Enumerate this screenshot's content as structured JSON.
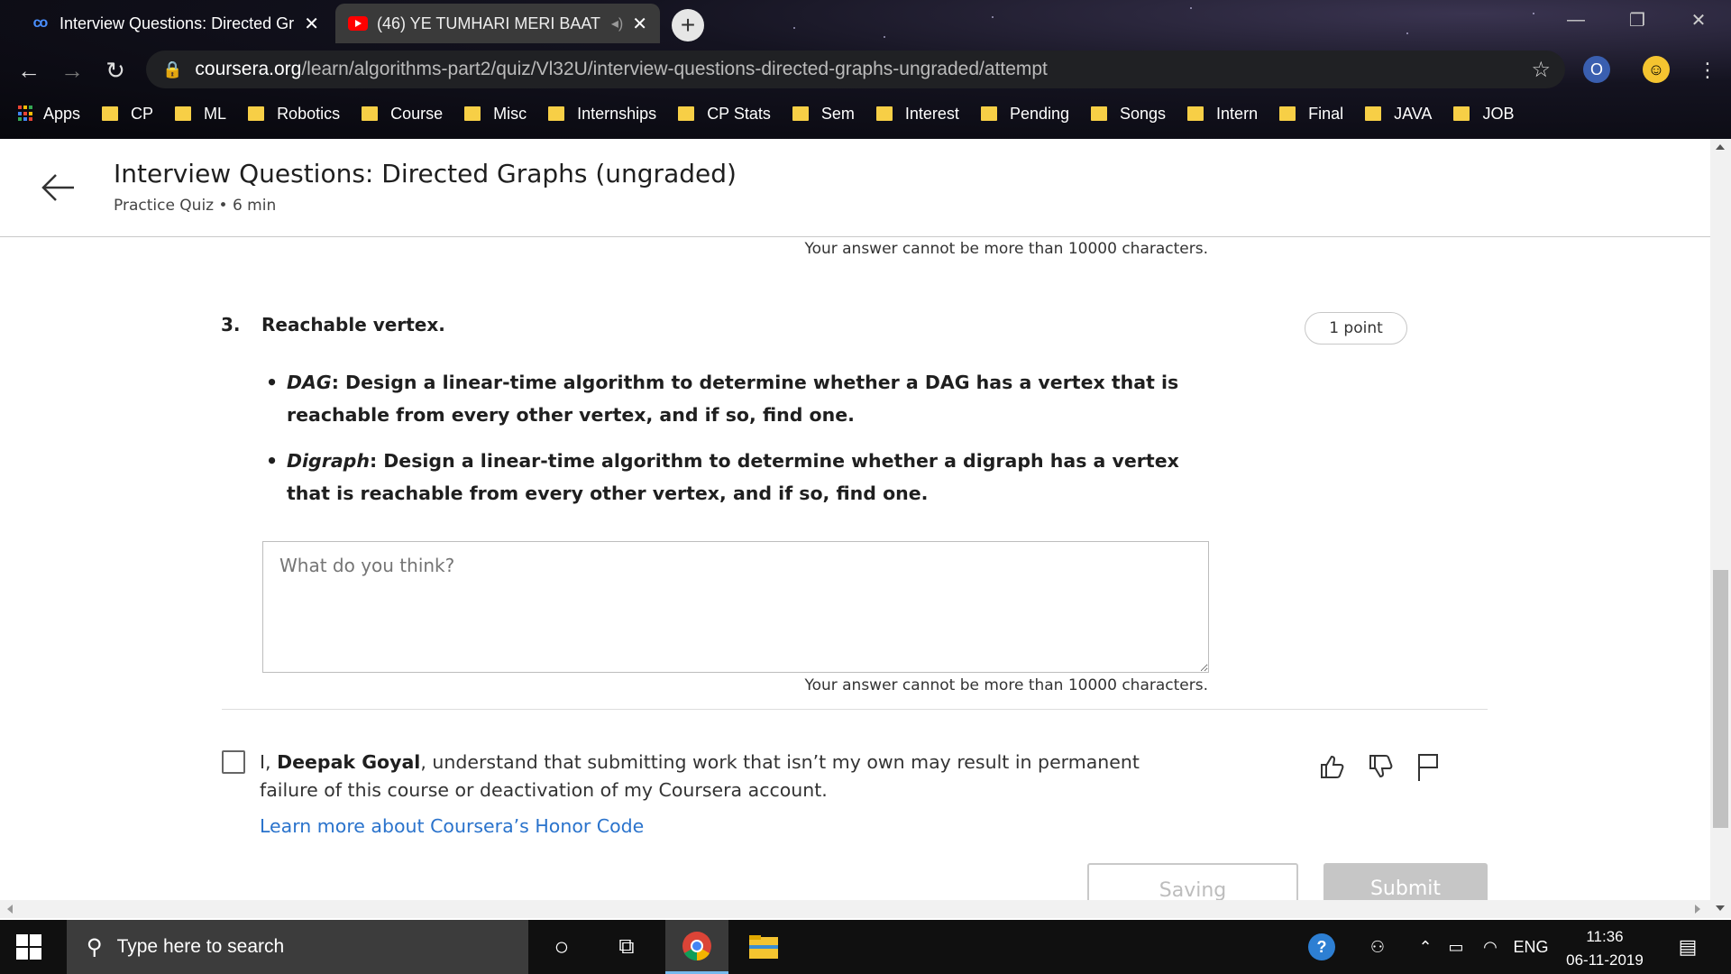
{
  "browser": {
    "tabs": [
      {
        "title": "Interview Questions: Directed Gr",
        "active": true
      },
      {
        "title": "(46) YE TUMHARI MERI BAAT",
        "active": false
      }
    ],
    "url_domain": "coursera.org",
    "url_path": "/learn/algorithms-part2/quiz/Vl32U/interview-questions-directed-graphs-ungraded/attempt",
    "bookmarks": [
      "Apps",
      "CP",
      "ML",
      "Robotics",
      "Course",
      "Misc",
      "Internships",
      "CP Stats",
      "Sem",
      "Interest",
      "Pending",
      "Songs",
      "Intern",
      "Final",
      "JAVA",
      "JOB"
    ]
  },
  "header": {
    "title": "Interview Questions: Directed Graphs (ungraded)",
    "subtitle": "Practice Quiz • 6 min"
  },
  "question": {
    "prev_limit_note": "Your answer cannot be more than 10000 characters.",
    "number": "3.",
    "title": "Reachable vertex.",
    "points": "1 point",
    "bullets": [
      {
        "term": "DAG",
        "text": ": Design a linear-time algorithm to determine whether a DAG has a vertex that is reachable from every other vertex, and if so, find one."
      },
      {
        "term": "Digraph",
        "text": ": Design a linear-time algorithm to determine whether a digraph has a vertex that is reachable from every other vertex, and if so, find one."
      }
    ],
    "answer_placeholder": "What do you think?",
    "limit_note": "Your answer cannot be more than 10000 characters."
  },
  "honor": {
    "prefix": "I, ",
    "name": "Deepak Goyal",
    "suffix": ", understand that submitting work that isn’t my own may result in permanent failure of this course or deactivation of my Coursera account.",
    "link": "Learn more about Coursera’s Honor Code"
  },
  "actions": {
    "saving": "Saving",
    "submit": "Submit"
  },
  "taskbar": {
    "search_placeholder": "Type here to search",
    "lang": "ENG",
    "time": "11:36",
    "date": "06-11-2019"
  },
  "colors": {
    "link": "#2a73cc",
    "folder": "#f7cf46",
    "taskbar": "#101010"
  }
}
